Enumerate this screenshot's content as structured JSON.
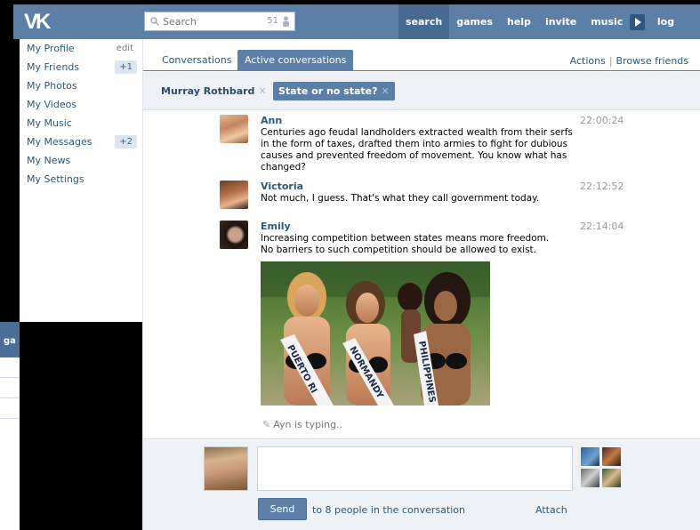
{
  "topbar": {
    "logo": "VK",
    "search_placeholder": "Search",
    "search_count": "51",
    "nav": [
      "search",
      "games",
      "help",
      "invite",
      "music",
      "log out"
    ]
  },
  "sidebar": {
    "items": [
      {
        "label": "My Profile",
        "aux": "edit"
      },
      {
        "label": "My Friends",
        "badge": "+1"
      },
      {
        "label": "My Photos"
      },
      {
        "label": "My Videos"
      },
      {
        "label": "My Music"
      },
      {
        "label": "My Messages",
        "badge": "+2"
      },
      {
        "label": "My News"
      },
      {
        "label": "My Settings"
      }
    ]
  },
  "ghost": {
    "label": "ga"
  },
  "tabs": {
    "conversations": "Conversations",
    "active": "Active conversations",
    "actions": "Actions",
    "browse": "Browse friends"
  },
  "conversation": {
    "chips": [
      {
        "label": "Murray Rothbard",
        "close": "✕"
      },
      {
        "label": "State or no state?",
        "close": "✕"
      }
    ]
  },
  "messages": [
    {
      "name": "Ann",
      "time": "22:00:24",
      "text": "Centuries ago feudal landholders extracted wealth from their serfs in the form of taxes, drafted them into armies to fight for dubious causes and prevented freedom of movement. You know what has changed?"
    },
    {
      "name": "Victoria",
      "time": "22:12:52",
      "text": "Not much, I guess. That's what they call government today."
    },
    {
      "name": "Emily",
      "time": "22:14:04",
      "text_line1": "Increasing competition between states means more freedom.",
      "text_line2": "No barriers to such competition should be allowed to exist."
    }
  ],
  "photo_sashes": [
    "PUERTO RI",
    "NORMANDY",
    "PHILIPPINES"
  ],
  "typing": "Ayn is typing..",
  "composer": {
    "send": "Send",
    "note": "to 8 people in the conversation",
    "attach": "Attach"
  },
  "colors": {
    "brand": "#5b7fa6",
    "link": "#2b587a",
    "panel": "#eef2f6"
  }
}
